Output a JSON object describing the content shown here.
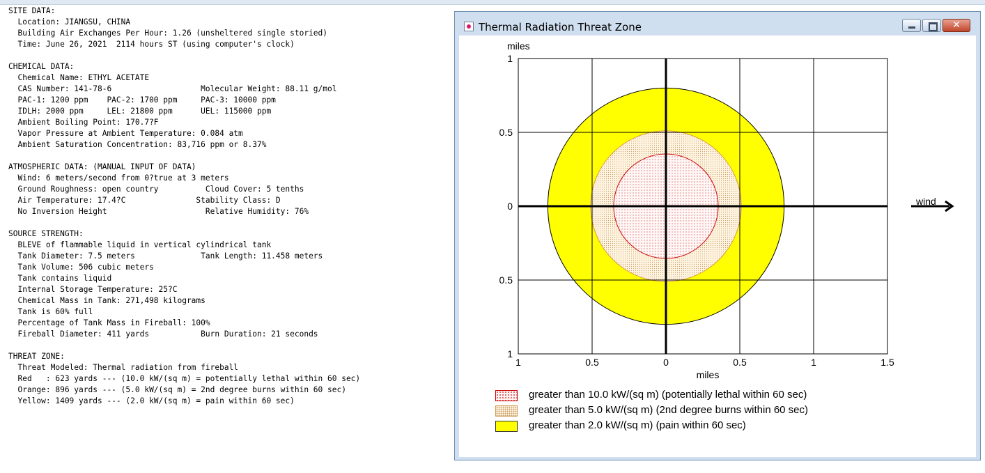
{
  "report": {
    "lines": [
      "SITE DATA:",
      "  Location: JIANGSU, CHINA",
      "  Building Air Exchanges Per Hour: 1.26 (unsheltered single storied)",
      "  Time: June 26, 2021  2114 hours ST (using computer's clock)",
      "",
      "CHEMICAL DATA:",
      "  Chemical Name: ETHYL ACETATE",
      "  CAS Number: 141-78-6                   Molecular Weight: 88.11 g/mol",
      "  PAC-1: 1200 ppm    PAC-2: 1700 ppm     PAC-3: 10000 ppm",
      "  IDLH: 2000 ppm     LEL: 21800 ppm      UEL: 115000 ppm",
      "  Ambient Boiling Point: 170.7?F",
      "  Vapor Pressure at Ambient Temperature: 0.084 atm",
      "  Ambient Saturation Concentration: 83,716 ppm or 8.37%",
      "",
      "ATMOSPHERIC DATA: (MANUAL INPUT OF DATA)",
      "  Wind: 6 meters/second from 0?true at 3 meters",
      "  Ground Roughness: open country          Cloud Cover: 5 tenths",
      "  Air Temperature: 17.4?C               Stability Class: D",
      "  No Inversion Height                     Relative Humidity: 76%",
      "",
      "SOURCE STRENGTH:",
      "  BLEVE of flammable liquid in vertical cylindrical tank",
      "  Tank Diameter: 7.5 meters              Tank Length: 11.458 meters",
      "  Tank Volume: 506 cubic meters",
      "  Tank contains liquid",
      "  Internal Storage Temperature: 25?C",
      "  Chemical Mass in Tank: 271,498 kilograms",
      "  Tank is 60% full",
      "  Percentage of Tank Mass in Fireball: 100%",
      "  Fireball Diameter: 411 yards           Burn Duration: 21 seconds",
      "",
      "THREAT ZONE:",
      "  Threat Modeled: Thermal radiation from fireball",
      "  Red   : 623 yards --- (10.0 kW/(sq m) = potentially lethal within 60 sec)",
      "  Orange: 896 yards --- (5.0 kW/(sq m) = 2nd degree burns within 60 sec)",
      "  Yellow: 1409 yards --- (2.0 kW/(sq m) = pain within 60 sec)"
    ]
  },
  "window": {
    "title": "Thermal Radiation Threat Zone",
    "icon": "app-icon",
    "buttons": {
      "minimize": "minimize-icon",
      "maximize": "maximize-icon",
      "close": "close-icon"
    }
  },
  "chart_data": {
    "type": "threat-zone",
    "xlabel": "miles",
    "ylabel": "miles",
    "xlim": [
      -1,
      1.5
    ],
    "ylim": [
      -1,
      1
    ],
    "x_ticks": [
      {
        "value": -1,
        "label": "1"
      },
      {
        "value": -0.5,
        "label": "0.5"
      },
      {
        "value": 0,
        "label": "0"
      },
      {
        "value": 0.5,
        "label": "0.5"
      },
      {
        "value": 1,
        "label": "1"
      },
      {
        "value": 1.5,
        "label": "1.5"
      }
    ],
    "y_ticks": [
      {
        "value": 1,
        "label": "1"
      },
      {
        "value": 0.5,
        "label": "0.5"
      },
      {
        "value": 0,
        "label": "0"
      },
      {
        "value": -0.5,
        "label": "0.5"
      },
      {
        "value": -1,
        "label": "1"
      }
    ],
    "grid": true,
    "zones": [
      {
        "name": "yellow",
        "radius_miles": 0.8,
        "fill": "#ffff00",
        "stroke": "#000000"
      },
      {
        "name": "orange",
        "radius_miles": 0.51,
        "fill": "#fff3dd",
        "stroke": "#e09a3a"
      },
      {
        "name": "red",
        "radius_miles": 0.354,
        "fill": "#fff4f4",
        "stroke": "#cc0000"
      }
    ],
    "wind_label": "wind",
    "legend": [
      {
        "swatch": "red",
        "label": "greater than 10.0 kW/(sq m) (potentially lethal within 60 sec)"
      },
      {
        "swatch": "orange",
        "label": "greater than 5.0 kW/(sq m) (2nd degree burns within 60 sec)"
      },
      {
        "swatch": "yellow",
        "label": "greater than 2.0 kW/(sq m) (pain within 60 sec)"
      }
    ]
  }
}
